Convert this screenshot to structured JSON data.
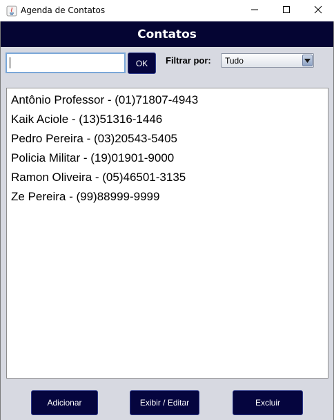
{
  "window": {
    "title": "Agenda de Contatos",
    "icons": [
      "java-app-icon",
      "minimize-icon",
      "maximize-icon",
      "close-icon"
    ]
  },
  "header": {
    "title": "Contatos"
  },
  "search": {
    "value": "",
    "ok_label": "OK"
  },
  "filter": {
    "label": "Filtrar por:",
    "selected": "Tudo"
  },
  "contacts": [
    "Antônio Professor - (01)71807-4943",
    "Kaik Aciole - (13)51316-1446",
    "Pedro Pereira - (03)20543-5405",
    "Policia Militar - (19)01901-9000",
    "Ramon Oliveira - (05)46501-3135",
    "Ze Pereira - (99)88999-9999"
  ],
  "actions": {
    "add_label": "Adicionar",
    "edit_label": "Exibir / Editar",
    "delete_label": "Excluir"
  },
  "colors": {
    "header_bg": "#050533",
    "button_bg": "#05053e",
    "panel_bg": "#d7d9e1"
  }
}
